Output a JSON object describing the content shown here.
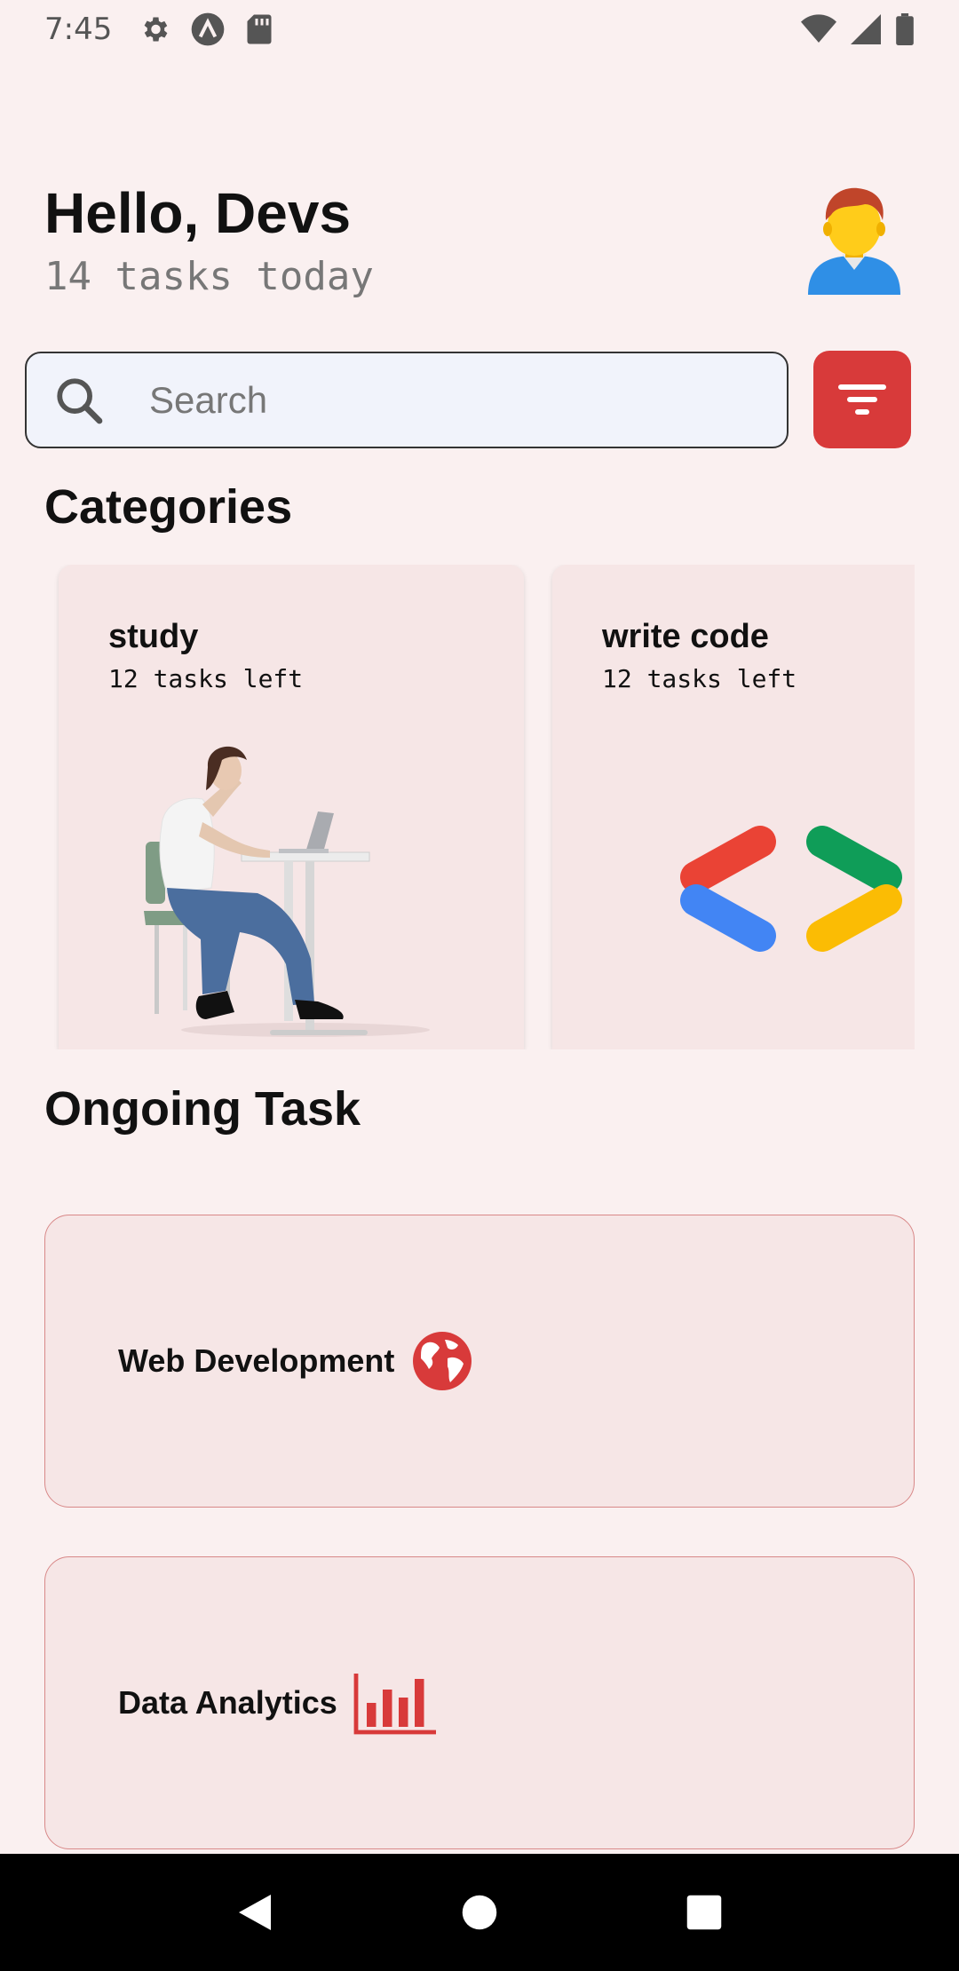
{
  "status_bar": {
    "time": "7:45",
    "left_icons": [
      "gear-icon",
      "a-circle-icon",
      "sd-card-icon"
    ],
    "right_icons": [
      "wifi-icon",
      "signal-icon",
      "battery-icon"
    ]
  },
  "header": {
    "title": "Hello, Devs",
    "subtitle": "14 tasks today",
    "avatar_icon": "person-avatar-icon"
  },
  "search": {
    "placeholder": "Search",
    "value": "",
    "icon": "search-icon"
  },
  "filter": {
    "icon": "filter-icon",
    "color": "#d83a3a"
  },
  "categories": {
    "title": "Categories",
    "items": [
      {
        "name": "study",
        "count": "12 tasks left",
        "illustration": "person-at-desk"
      },
      {
        "name": "write code",
        "count": "12 tasks left",
        "illustration": "code-brackets"
      }
    ]
  },
  "ongoing": {
    "title": "Ongoing Task",
    "items": [
      {
        "label": "Web Development",
        "icon": "globe-icon"
      },
      {
        "label": "Data Analytics",
        "icon": "bar-chart-icon"
      }
    ]
  },
  "colors": {
    "background": "#faf0f0",
    "card": "#f6e6e6",
    "accent": "#d83a3a"
  },
  "nav": {
    "buttons": [
      "back-icon",
      "home-icon",
      "recents-icon"
    ]
  }
}
